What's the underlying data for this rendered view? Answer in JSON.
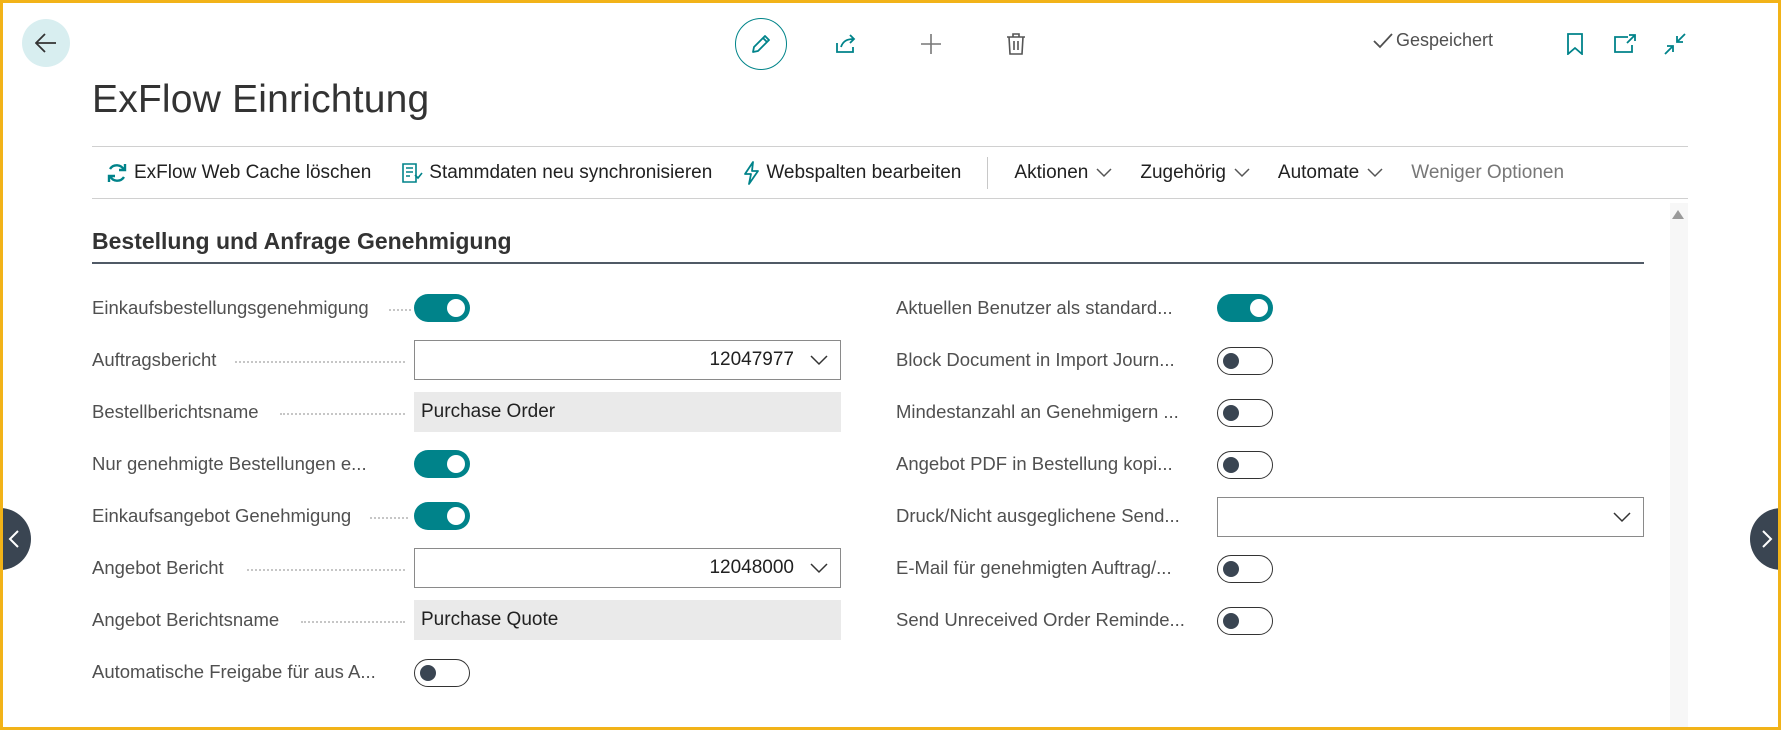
{
  "header": {
    "saved_label": "Gespeichert",
    "page_title": "ExFlow Einrichtung"
  },
  "actions": {
    "clear_cache": "ExFlow Web Cache löschen",
    "resync": "Stammdaten neu synchronisieren",
    "edit_columns": "Webspalten bearbeiten",
    "menu_actions": "Aktionen",
    "menu_related": "Zugehörig",
    "menu_automate": "Automate",
    "fewer_options": "Weniger Optionen"
  },
  "section": {
    "title": "Bestellung und Anfrage Genehmigung"
  },
  "left_fields": [
    {
      "label": "Einkaufsbestellungsgenehmigung",
      "type": "toggle",
      "value": true
    },
    {
      "label": "Auftragsbericht",
      "type": "dropdown",
      "value": "12047977"
    },
    {
      "label": "Bestellberichtsname",
      "type": "readonly",
      "value": "Purchase Order"
    },
    {
      "label": "Nur genehmigte Bestellungen e...",
      "type": "toggle",
      "value": true
    },
    {
      "label": "Einkaufsangebot Genehmigung",
      "type": "toggle",
      "value": true
    },
    {
      "label": "Angebot Bericht",
      "type": "dropdown",
      "value": "12048000"
    },
    {
      "label": "Angebot Berichtsname",
      "type": "readonly",
      "value": "Purchase Quote"
    },
    {
      "label": "Automatische Freigabe für aus A...",
      "type": "toggle",
      "value": false
    }
  ],
  "right_fields": [
    {
      "label": "Aktuellen Benutzer als standard...",
      "type": "toggle",
      "value": true
    },
    {
      "label": "Block Document in Import Journ...",
      "type": "toggle",
      "value": false
    },
    {
      "label": "Mindestanzahl an Genehmigern ...",
      "type": "toggle",
      "value": false
    },
    {
      "label": "Angebot PDF in Bestellung kopi...",
      "type": "toggle",
      "value": false
    },
    {
      "label": "Druck/Nicht ausgeglichene Send...",
      "type": "dropdown",
      "value": ""
    },
    {
      "label": "E-Mail für genehmigten Auftrag/...",
      "type": "toggle",
      "value": false
    },
    {
      "label": "Send Unreceived Order Reminde...",
      "type": "toggle",
      "value": false
    }
  ],
  "colors": {
    "accent": "#00838a",
    "frame": "#f2b318"
  }
}
